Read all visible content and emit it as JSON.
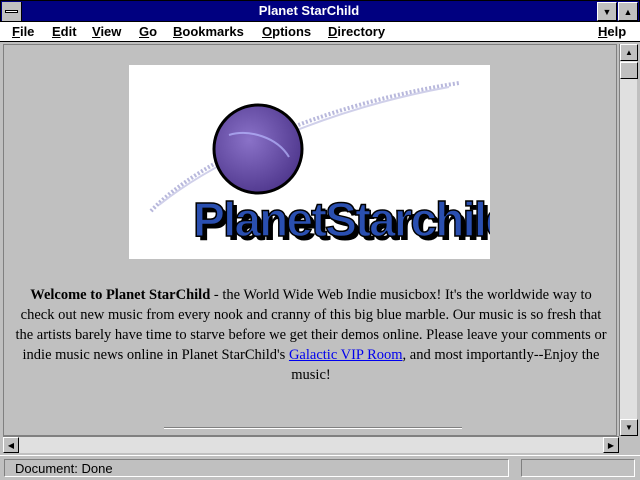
{
  "window": {
    "title": "Planet StarChild"
  },
  "menu": [
    {
      "key": "F",
      "rest": "ile"
    },
    {
      "key": "E",
      "rest": "dit"
    },
    {
      "key": "V",
      "rest": "iew"
    },
    {
      "key": "G",
      "rest": "o"
    },
    {
      "key": "B",
      "rest": "ookmarks"
    },
    {
      "key": "O",
      "rest": "ptions"
    },
    {
      "key": "D",
      "rest": "irectory"
    },
    {
      "key": "H",
      "rest": "elp"
    }
  ],
  "page": {
    "logo_text": "PlanetStarchild",
    "welcome_bold": "Welcome to Planet StarChild",
    "welcome_text": " - the World Wide Web Indie musicbox! It's the worldwide way to check out new music from every nook and cranny of this big blue marble. Our music is so fresh that the artists barely have time to starve before we get their demos online. Please leave your comments or indie music news online in Planet StarChild's ",
    "link_text": "Galactic VIP Room",
    "welcome_end": ", and most importantly--Enjoy the music!"
  },
  "status": {
    "text": "Document: Done",
    "progress": 0
  },
  "colors": {
    "title_bar": "#000080",
    "planet": "#6a52a8",
    "logo_text_blue": "#2a4fb0",
    "logo_text_purple": "#5a3a9a",
    "link": "#0000ee"
  }
}
